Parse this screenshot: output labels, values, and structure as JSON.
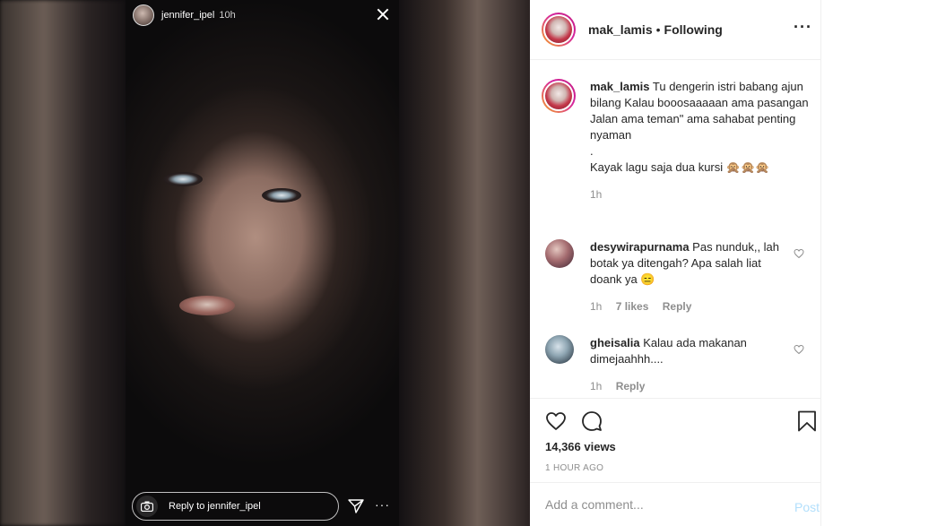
{
  "story": {
    "username": "jennifer_ipel",
    "time": "10h",
    "reply_placeholder": "Reply to jennifer_ipel",
    "more_label": "···"
  },
  "post": {
    "username": "mak_lamis",
    "separator": "•",
    "follow_status": "Following",
    "more_label": "···",
    "caption": {
      "username": "mak_lamis",
      "lines": [
        "Tu dengerin istri babang ajun bilang Kalau booosaaaaan ama pasangan",
        "Jalan ama teman\" ama sahabat penting nyaman",
        ".",
        "Kayak lagu saja dua kursi 🙊🙊🙊"
      ],
      "time": "1h"
    },
    "comments": [
      {
        "username": "desywirapurnama",
        "text": "Pas nunduk,, lah botak ya ditengah? Apa salah liat doank ya 😑",
        "time": "1h",
        "likes": "7 likes",
        "reply_label": "Reply"
      },
      {
        "username": "gheisalia",
        "text": "Kalau ada makanan dimejaahhh....",
        "time": "1h",
        "reply_label": "Reply"
      }
    ],
    "views": "14,366 views",
    "posted": "1 HOUR AGO",
    "add_comment_placeholder": "Add a comment...",
    "post_label": "Post"
  },
  "colors": {
    "link_disabled": "#b2dffc",
    "muted": "#8e8e8e",
    "text": "#262626"
  }
}
